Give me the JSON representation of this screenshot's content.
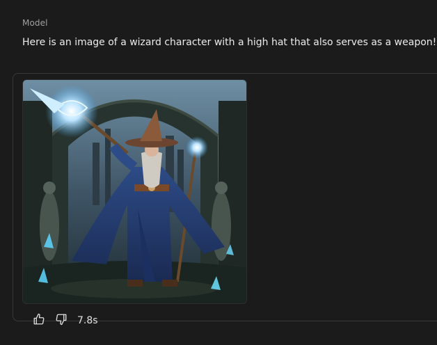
{
  "message": {
    "role_label": "Model",
    "text": "Here is an image of a wizard character with a high hat that also serves as a weapon!"
  },
  "image": {
    "description_icon": "wizard-illustration"
  },
  "actions": {
    "thumbs_up_icon": "thumbs-up-icon",
    "thumbs_down_icon": "thumbs-down-icon",
    "elapsed_time": "7.8s"
  },
  "colors": {
    "background": "#1b1b1b",
    "text": "#ececec",
    "muted": "#a0a0a0",
    "border": "#3a3a3a"
  }
}
